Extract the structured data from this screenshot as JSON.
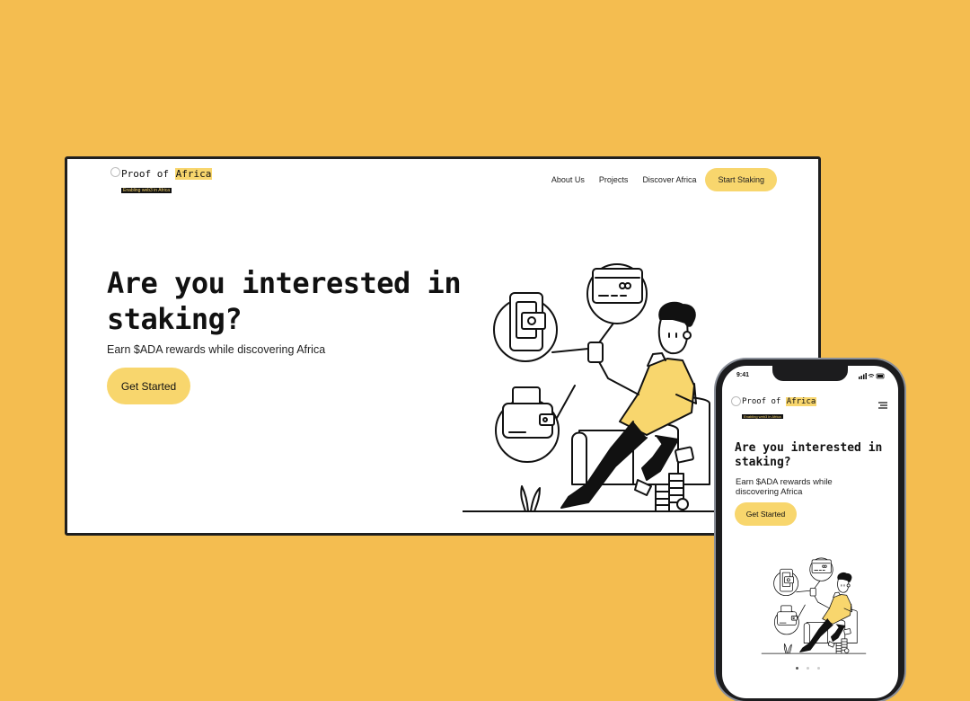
{
  "brand": {
    "name_prefix": "Proof of ",
    "name_highlight": "Africa",
    "tagline": "Enabling web3 in Africa"
  },
  "nav": {
    "items": [
      "About Us",
      "Projects",
      "Discover Africa"
    ],
    "cta": "Start Staking"
  },
  "hero": {
    "title": "Are you interested in staking?",
    "subtitle": "Earn $ADA rewards while discovering Africa",
    "button": "Get Started"
  },
  "mobile": {
    "time": "9:41"
  },
  "colors": {
    "background": "#F4BD50",
    "accent": "#F8D66D",
    "text": "#111111"
  },
  "icons": [
    "phone-wallet-icon",
    "credit-card-icon",
    "wallet-icon",
    "menu-icon",
    "signal-icon",
    "wifi-icon",
    "battery-icon"
  ]
}
